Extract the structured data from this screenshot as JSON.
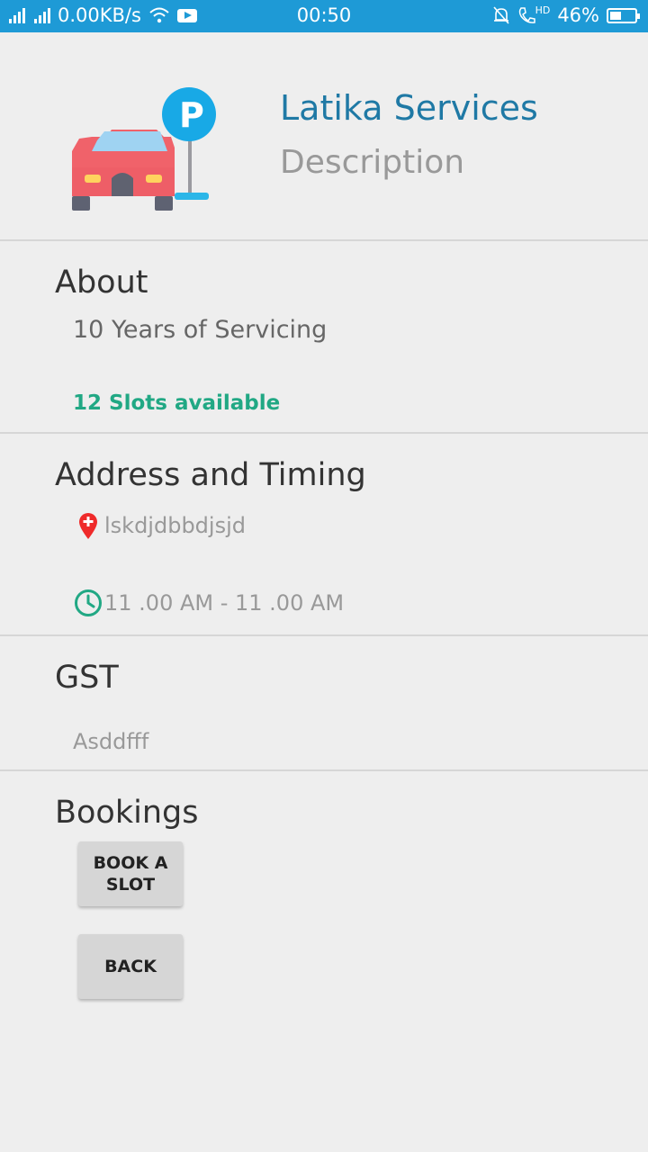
{
  "status_bar": {
    "network_speed": "0.00KB/s",
    "time": "00:50",
    "hd_label": "HD",
    "battery": "46%",
    "battery_level": 0.46,
    "icons": [
      "signal-icon",
      "signal-icon",
      "wifi-icon",
      "youtube-icon",
      "mute-icon",
      "call-hd-icon",
      "battery-icon"
    ]
  },
  "header": {
    "title": "Latika Services",
    "subtitle": "Description",
    "logo_icon": "car-parking-icon"
  },
  "about": {
    "heading": "About",
    "text": "10 Years of Servicing",
    "slots": "12 Slots available"
  },
  "address": {
    "heading": "Address and Timing",
    "location": "lskdjdbbdjsjd",
    "timing": "11 .00 AM - 11 .00 AM",
    "location_icon": "location-pin-icon",
    "clock_icon": "clock-icon"
  },
  "gst": {
    "heading": "GST",
    "value": "Asddfff"
  },
  "bookings": {
    "heading": "Bookings",
    "book_label": "BOOK A SLOT",
    "back_label": "BACK"
  },
  "colors": {
    "status_bar": "#1e9ad6",
    "title": "#1f79a5",
    "slots": "#21a884",
    "background": "#eeeeee"
  }
}
